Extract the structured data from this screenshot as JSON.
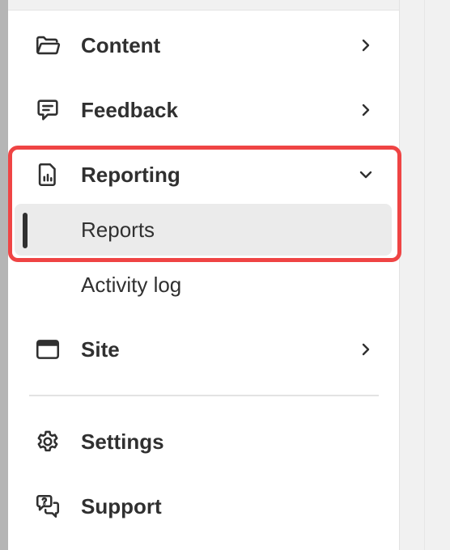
{
  "nav": {
    "content": {
      "label": "Content",
      "icon": "folder-icon"
    },
    "feedback": {
      "label": "Feedback",
      "icon": "feedback-icon"
    },
    "reporting": {
      "label": "Reporting",
      "icon": "report-icon",
      "expanded": true,
      "children": [
        {
          "label": "Reports",
          "active": true
        },
        {
          "label": "Activity log",
          "active": false
        }
      ]
    },
    "site": {
      "label": "Site",
      "icon": "browser-window-icon"
    },
    "settings": {
      "label": "Settings",
      "icon": "gear-icon"
    },
    "support": {
      "label": "Support",
      "icon": "support-chat-icon"
    }
  },
  "colors": {
    "highlight": "#ef4444",
    "active_bg": "#ebebeb",
    "text": "#303030"
  }
}
